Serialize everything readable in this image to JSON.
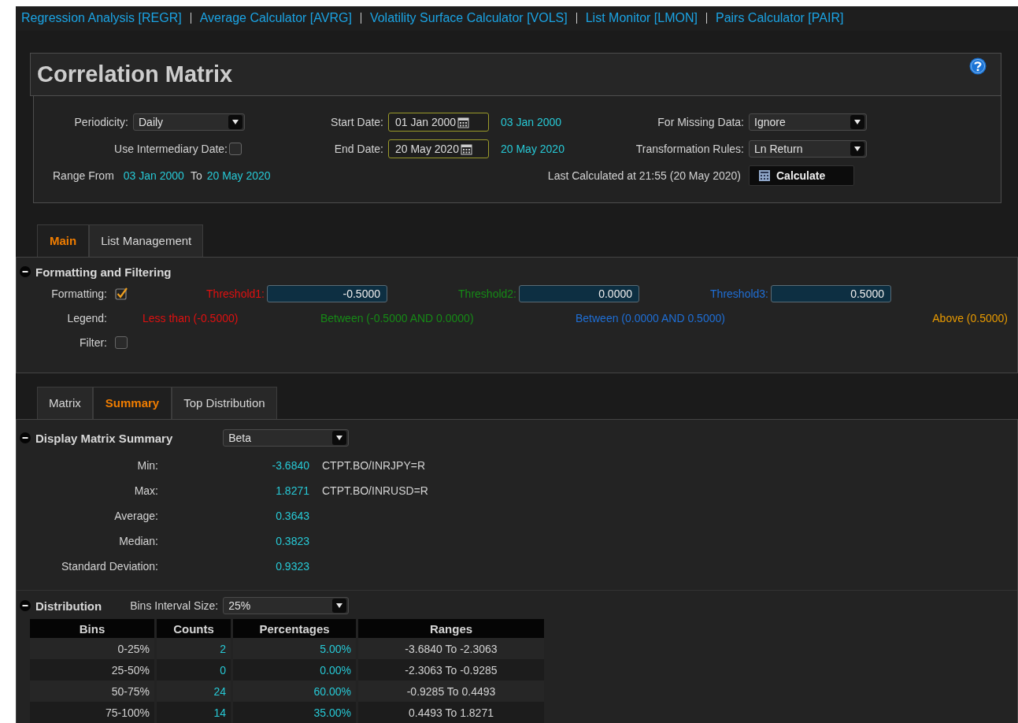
{
  "nav_links": [
    {
      "label": "Regression Analysis [REGR]"
    },
    {
      "label": "Average Calculator [AVRG]"
    },
    {
      "label": "Volatility Surface Calculator [VOLS]"
    },
    {
      "label": "List Monitor [LMON]"
    },
    {
      "label": "Pairs Calculator [PAIR]"
    }
  ],
  "header": {
    "title": "Correlation Matrix"
  },
  "parameters": {
    "periodicity": {
      "label": "Periodicity:",
      "value": "Daily"
    },
    "use_intermediary_date": {
      "label": "Use Intermediary Date:",
      "checked": false
    },
    "range": {
      "from_label": "Range From",
      "from": "03 Jan 2000",
      "to_label": "To",
      "to": "20 May 2020"
    },
    "start_date": {
      "label": "Start Date:",
      "value": "01 Jan 2000",
      "resolved": "03 Jan 2000"
    },
    "end_date": {
      "label": "End Date:",
      "value": "20 May 2020",
      "resolved": "20 May 2020"
    },
    "missing_data": {
      "label": "For Missing Data:",
      "value": "Ignore"
    },
    "transformation": {
      "label": "Transformation Rules:",
      "value": "Ln Return"
    },
    "last_calculated": "Last Calculated at 21:55 (20 May 2020)",
    "calculate_button": "Calculate"
  },
  "main_tabs": [
    {
      "label": "Main",
      "selected": true
    },
    {
      "label": "List Management",
      "selected": false
    }
  ],
  "formatting_section": {
    "title": "Formatting and Filtering",
    "expanded": true,
    "formatting": {
      "label": "Formatting:",
      "checked": true
    },
    "thresholds": [
      {
        "label": "Threshold1:",
        "value": "-0.5000",
        "color": "#e01010"
      },
      {
        "label": "Threshold2:",
        "value": "0.0000",
        "color": "#168a16"
      },
      {
        "label": "Threshold3:",
        "value": "0.5000",
        "color": "#1f6fd6"
      }
    ],
    "legend_label": "Legend:",
    "legend": [
      {
        "text": "Less than (-0.5000)",
        "color": "#e01010"
      },
      {
        "text": "Between (-0.5000 AND 0.0000)",
        "color": "#168a16"
      },
      {
        "text": "Between (0.0000 AND 0.5000)",
        "color": "#1f6fd6"
      },
      {
        "text": "Above (0.5000)",
        "color": "#e89a00"
      }
    ],
    "filter": {
      "label": "Filter:",
      "checked": false
    }
  },
  "view_tabs": [
    {
      "label": "Matrix",
      "selected": false
    },
    {
      "label": "Summary",
      "selected": true
    },
    {
      "label": "Top Distribution",
      "selected": false
    }
  ],
  "summary": {
    "title": "Display Matrix Summary",
    "expanded": true,
    "measure": "Beta",
    "stats": [
      {
        "label": "Min:",
        "value": "-3.6840",
        "pair": "CTPT.BO/INRJPY=R"
      },
      {
        "label": "Max:",
        "value": "1.8271",
        "pair": "CTPT.BO/INRUSD=R"
      },
      {
        "label": "Average:",
        "value": "0.3643"
      },
      {
        "label": "Median:",
        "value": "0.3823"
      },
      {
        "label": "Standard Deviation:",
        "value": "0.9323"
      }
    ]
  },
  "distribution": {
    "title": "Distribution",
    "expanded": true,
    "bins_label": "Bins Interval Size:",
    "bins_value": "25%",
    "columns": [
      "Bins",
      "Counts",
      "Percentages",
      "Ranges"
    ],
    "rows": [
      {
        "bins": "0-25%",
        "counts": "2",
        "percentages": "5.00%",
        "ranges": "-3.6840 To -2.3063"
      },
      {
        "bins": "25-50%",
        "counts": "0",
        "percentages": "0.00%",
        "ranges": "-2.3063 To -0.9285"
      },
      {
        "bins": "50-75%",
        "counts": "24",
        "percentages": "60.00%",
        "ranges": "-0.9285 To 0.4493"
      },
      {
        "bins": "75-100%",
        "counts": "14",
        "percentages": "35.00%",
        "ranges": "0.4493 To 1.8271"
      }
    ]
  }
}
